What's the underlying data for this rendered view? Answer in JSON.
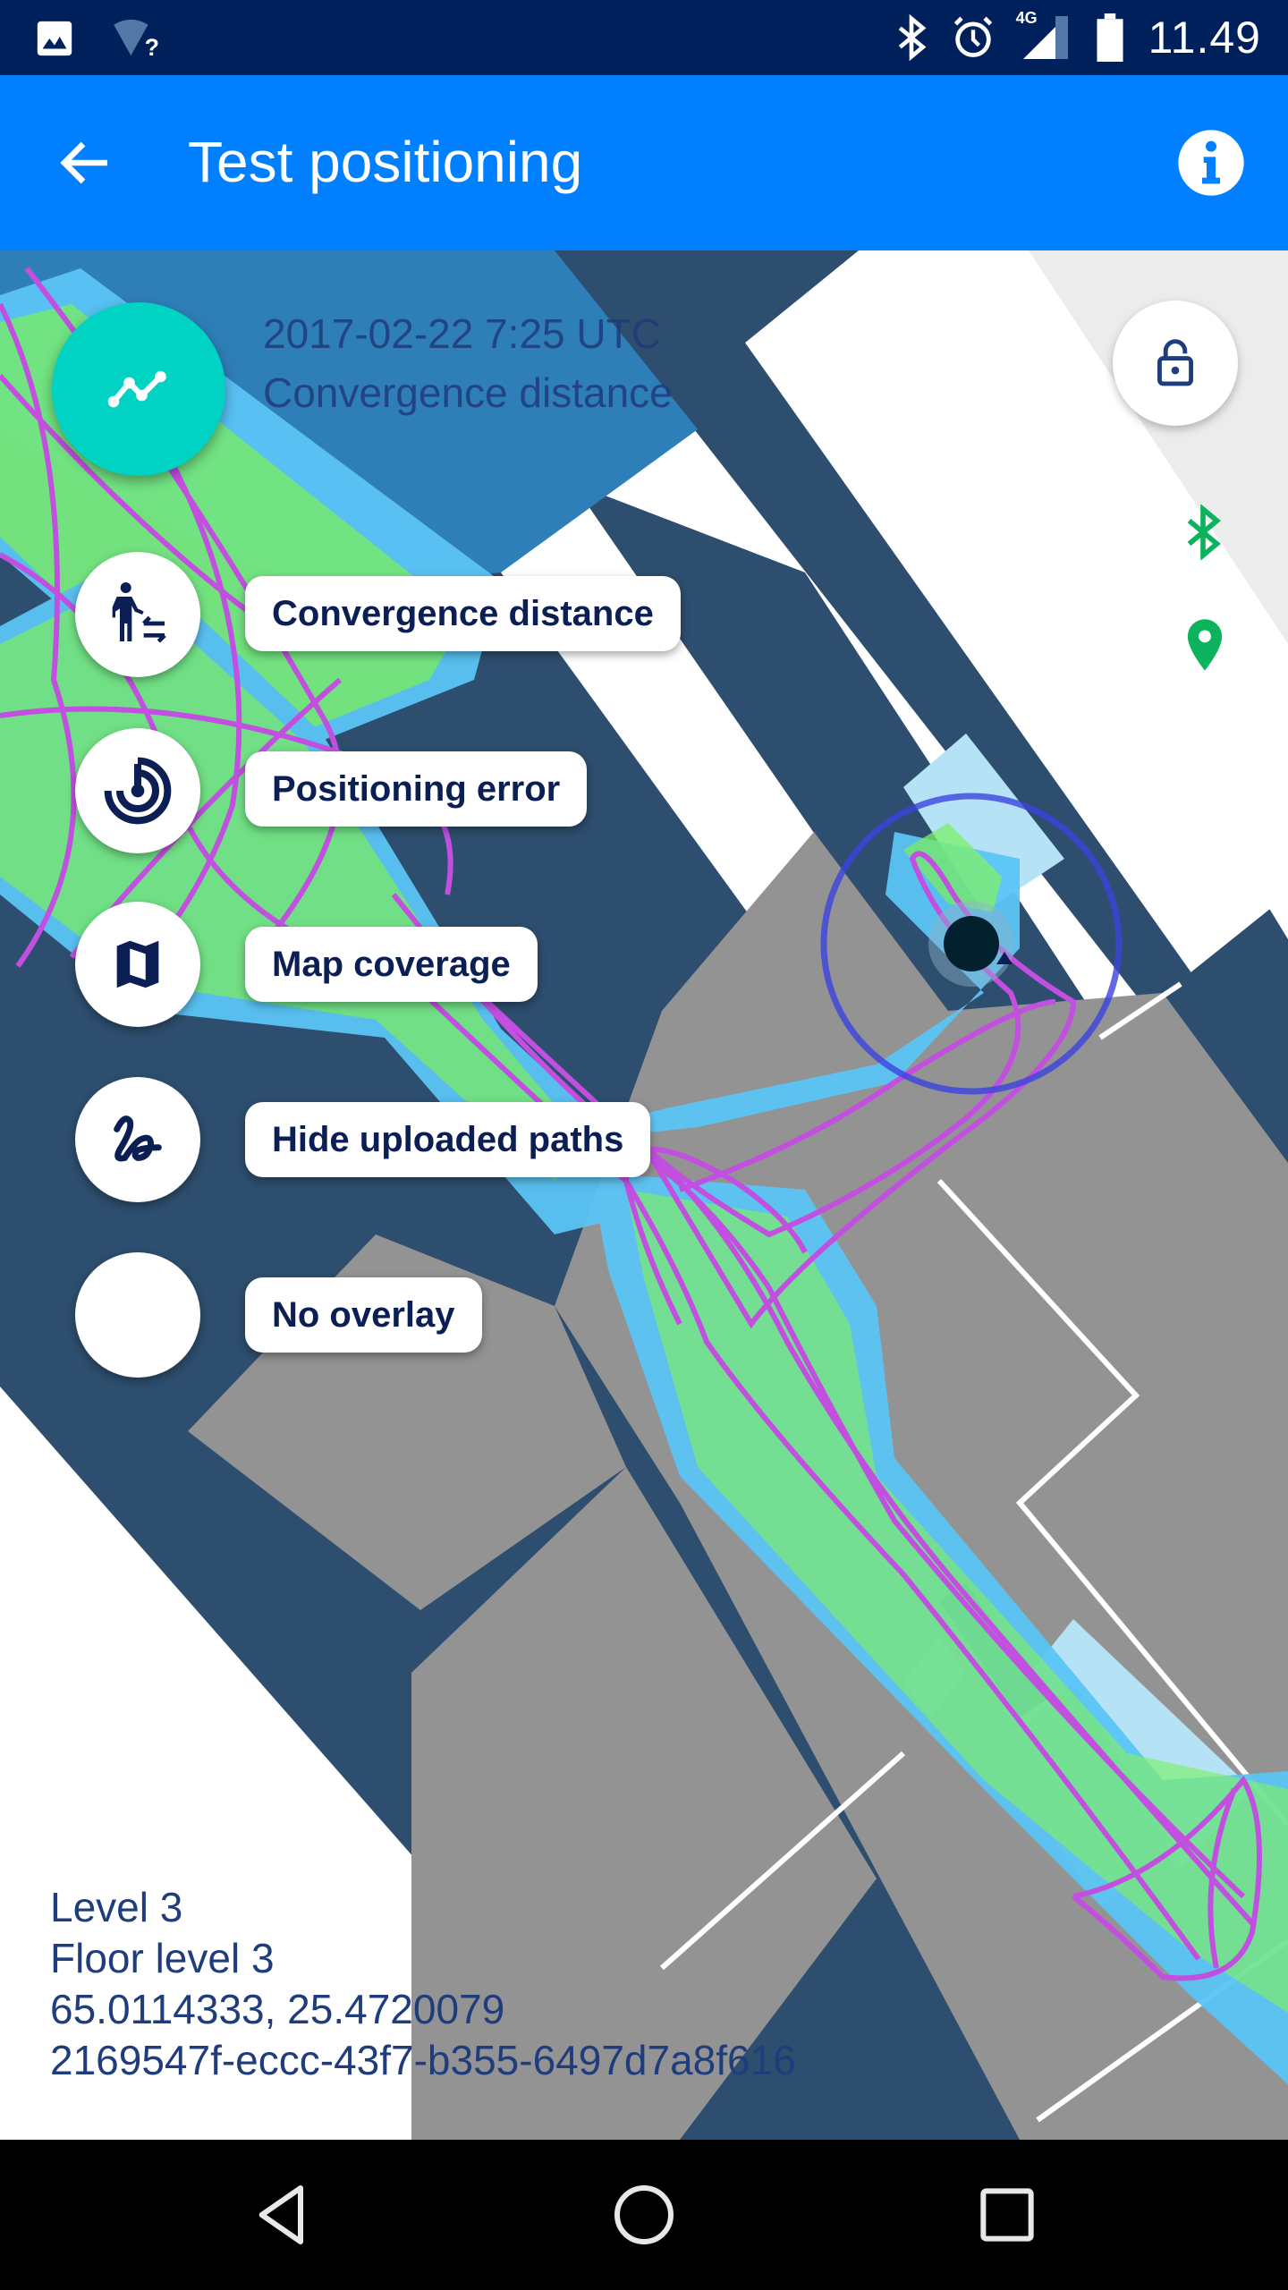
{
  "status_bar": {
    "time": "11.49",
    "network_label": "4G",
    "icons": [
      "image-notification-icon",
      "wifi-unknown-icon",
      "bluetooth-icon",
      "alarm-icon",
      "signal-4g-icon",
      "battery-icon"
    ]
  },
  "app_bar": {
    "title": "Test positioning",
    "back_icon": "arrow-back-icon",
    "info_icon": "info-icon"
  },
  "overlay_header": {
    "timestamp": "2017-02-22 7:25 UTC",
    "overlay_name": "Convergence distance"
  },
  "fab_menu": {
    "main_icon": "timeline-icon",
    "main_color": "#00d2c3",
    "items": [
      {
        "label": "Convergence distance",
        "icon": "walking-person-arrows-icon"
      },
      {
        "label": "Positioning error",
        "icon": "target-icon"
      },
      {
        "label": "Map coverage",
        "icon": "map-icon"
      },
      {
        "label": "Hide uploaded paths",
        "icon": "squiggle-path-icon"
      },
      {
        "label": "No overlay",
        "icon": ""
      }
    ]
  },
  "map_controls": {
    "lock_icon": "lock-open-icon",
    "bluetooth_status_color": "#0db35c",
    "location_status_color": "#0db35c"
  },
  "location_info": {
    "level": "Level 3",
    "floor": "Floor level 3",
    "coordinates": "65.0114333, 25.4720079",
    "building_id": "2169547f-eccc-43f7-b355-6497d7a8f616"
  },
  "nav_bar": {
    "back": "nav-back-icon",
    "home": "nav-home-icon",
    "recents": "nav-recents-icon"
  },
  "colors": {
    "status_bar": "#00205b",
    "app_bar": "#007fff",
    "text_dark": "#0b1f55",
    "map_corridor": "#2d4e6e",
    "map_room": "#939393",
    "path": "#c24fe0"
  }
}
